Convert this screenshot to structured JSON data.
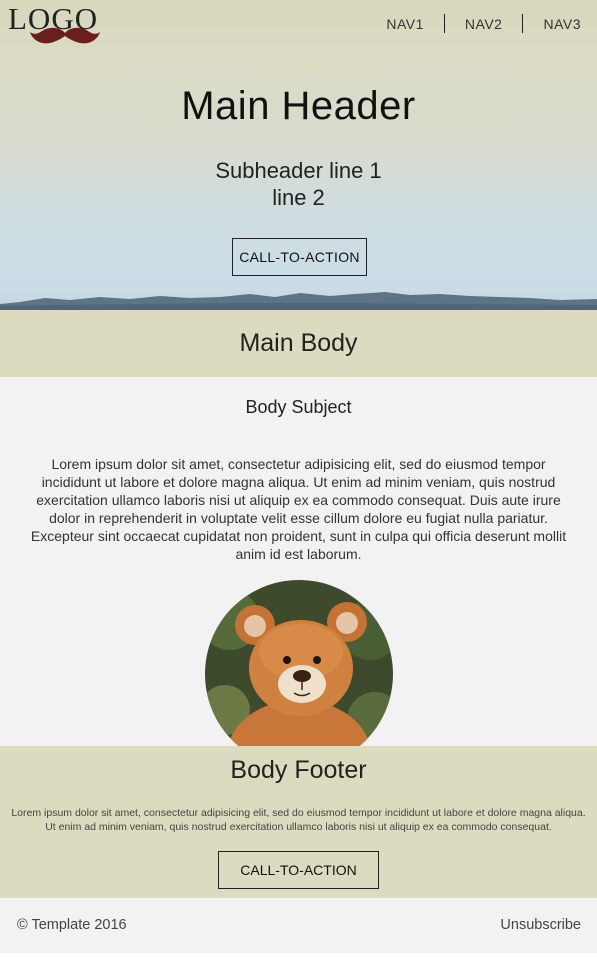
{
  "logo": {
    "text": "LOGO",
    "mustache_color": "#6b1f1a"
  },
  "nav": {
    "items": [
      "NAV1",
      "NAV2",
      "NAV3"
    ]
  },
  "hero": {
    "title": "Main Header",
    "subtitle_line1": "Subheader line 1",
    "subtitle_line2": "line 2",
    "cta_label": "CALL-TO-ACTION"
  },
  "main_body": {
    "title": "Main Body",
    "subject": "Body Subject",
    "text": "Lorem ipsum dolor sit amet, consectetur adipisicing elit, sed do eiusmod tempor incididunt ut labore et dolore magna aliqua. Ut enim ad minim veniam, quis nostrud exercitation ullamco laboris nisi ut aliquip ex ea commodo consequat. Duis aute irure dolor in reprehenderit in voluptate velit esse cillum dolore eu fugiat nulla pariatur. Excepteur sint occaecat cupidatat non proident, sunt in culpa qui officia deserunt mollit anim id est laborum.",
    "image": "teddy-bear"
  },
  "body_footer": {
    "title": "Body Footer",
    "text": "Lorem ipsum dolor sit amet, consectetur adipisicing elit, sed do eiusmod tempor incididunt ut labore et dolore magna aliqua. Ut enim ad minim veniam, quis nostrud exercitation ullamco laboris nisi ut aliquip ex ea commodo consequat.",
    "cta_label": "CALL-TO-ACTION"
  },
  "footer": {
    "copyright": "© Template 2016",
    "unsubscribe": "Unsubscribe"
  },
  "colors": {
    "band": "#dcdbc0",
    "content_bg": "#f2f2f2"
  }
}
